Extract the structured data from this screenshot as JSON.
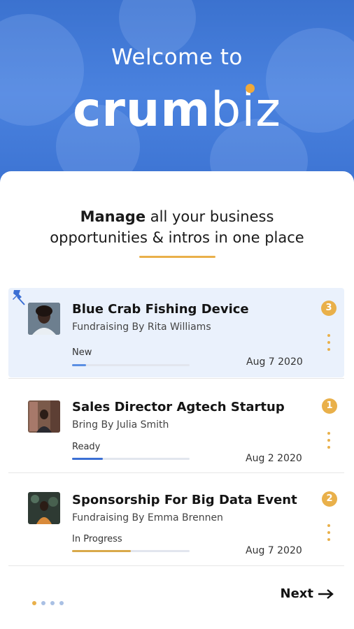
{
  "hero": {
    "welcome": "Welcome to",
    "logo_part1": "crum",
    "logo_part2": "biz"
  },
  "intro": {
    "headline_bold": "Manage",
    "headline_rest1": " all your  business",
    "headline_rest2": "opportunities & intros in one place"
  },
  "items": [
    {
      "title": "Blue Crab Fishing Device",
      "subtitle": "Fundraising By Rita Williams",
      "status": "New",
      "progress": 0.12,
      "progress_color": "#5b8fe3",
      "date": "Aug 7 2020",
      "badge": "3",
      "pinned": true,
      "avatar": "avatar-rita"
    },
    {
      "title": "Sales Director Agtech Startup",
      "subtitle": "Bring By Julia Smith",
      "status": "Ready",
      "progress": 0.26,
      "progress_color": "#3b6fd4",
      "date": "Aug 2 2020",
      "badge": "1",
      "pinned": false,
      "avatar": "avatar-julia"
    },
    {
      "title": "Sponsorship For Big Data Event",
      "subtitle": "Fundraising By Emma Brennen",
      "status": "In Progress",
      "progress": 0.5,
      "progress_color": "#d9a94a",
      "date": "Aug 7 2020",
      "badge": "2",
      "pinned": false,
      "avatar": "avatar-emma"
    }
  ],
  "footer": {
    "next_label": "Next",
    "page_count": 4,
    "active_page": 1
  },
  "colors": {
    "accent": "#e9b04a",
    "brand_blue": "#3f78d6",
    "highlight_bg": "#eaf1fc"
  }
}
